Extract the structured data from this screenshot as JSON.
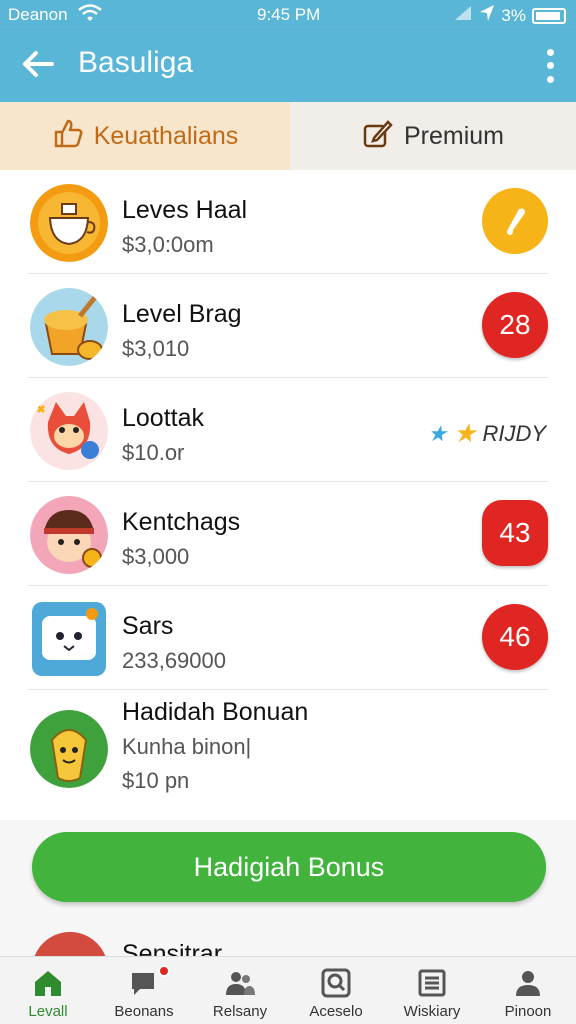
{
  "status_bar": {
    "carrier": "Deanon",
    "time": "9:45 PM",
    "battery": "3%"
  },
  "app_bar": {
    "title": "Basuliga"
  },
  "tabs": [
    {
      "label": "Keuathalians",
      "icon": "hand-icon"
    },
    {
      "label": "Premium",
      "icon": "edit-icon"
    }
  ],
  "list": [
    {
      "title": "Leves Haal",
      "subtitle": "$3,0:0om",
      "badge": "",
      "badge_type": "gold"
    },
    {
      "title": "Level Brag",
      "subtitle": "$3,010",
      "badge": "28",
      "badge_type": "red"
    },
    {
      "title": "Loottak",
      "subtitle": "$10.or",
      "badge": "RIJDY",
      "badge_type": "ready"
    },
    {
      "title": "Kentchags",
      "subtitle": "$3,000",
      "badge": "43",
      "badge_type": "gear"
    },
    {
      "title": "Sars",
      "subtitle": "233,69000",
      "badge": "46",
      "badge_type": "red"
    },
    {
      "title": "Hadidah Bonuan",
      "subtitle": "Kunha binon|",
      "price": "$10 pn",
      "badge": "",
      "badge_type": "none"
    }
  ],
  "bonus_button": {
    "label": "Hadigiah Bonus"
  },
  "peek": {
    "title": "Sensitrar"
  },
  "bottom_nav": [
    {
      "label": "Levall",
      "icon": "home-icon",
      "active": true
    },
    {
      "label": "Beonans",
      "icon": "chat-icon",
      "active": false,
      "notification": true
    },
    {
      "label": "Relsany",
      "icon": "people-icon",
      "active": false
    },
    {
      "label": "Aceselo",
      "icon": "search-box-icon",
      "active": false
    },
    {
      "label": "Wiskiary",
      "icon": "list-icon",
      "active": false
    },
    {
      "label": "Pinoon",
      "icon": "person-icon",
      "active": false
    }
  ],
  "colors": {
    "header": "#5ab6d6",
    "active_tab": "#f8e6cc",
    "accent_green": "#42b33c",
    "badge_red": "#e02622",
    "badge_gold": "#f6b419"
  }
}
